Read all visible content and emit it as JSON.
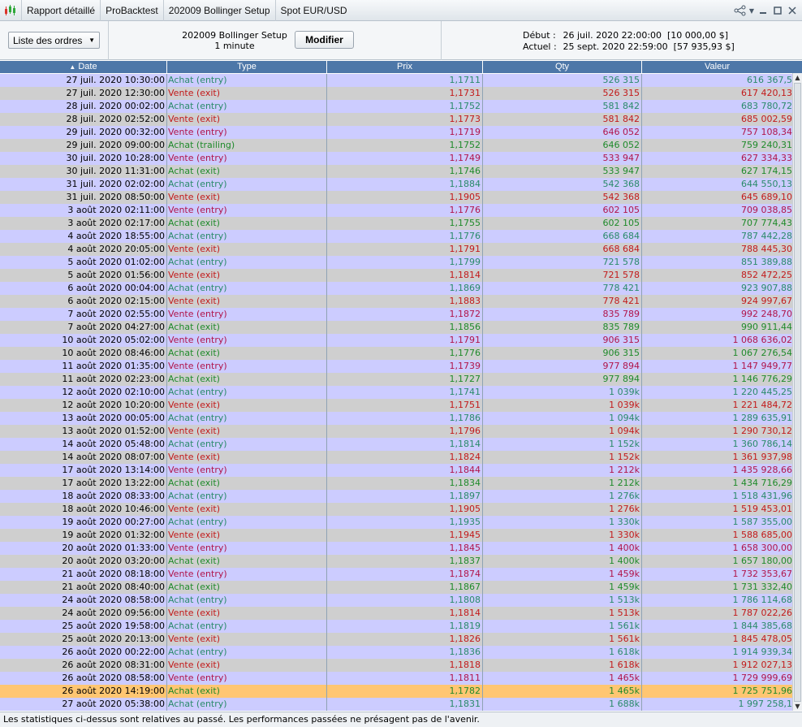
{
  "titlebar": {
    "crumbs": [
      "Rapport détaillé",
      "ProBacktest",
      "202009 Bollinger Setup",
      "Spot EUR/USD"
    ],
    "icons": [
      "chart-icon",
      "share-icon",
      "minimize-icon",
      "maximize-icon",
      "close-icon"
    ]
  },
  "toolbar": {
    "orders_label": "Liste des ordres",
    "setup_name": "202009 Bollinger Setup",
    "timeframe": "1 minute",
    "modify_label": "Modifier",
    "start_label": "Début :",
    "start_value": "26 juil. 2020 22:00:00  [10 000,00 $]",
    "current_label": "Actuel :",
    "current_value": "25 sept. 2020 22:59:00  [57 935,93 $]"
  },
  "columns": [
    "Date",
    "Type",
    "Prix",
    "Qty",
    "Valeur"
  ],
  "rows": [
    [
      "27 juil. 2020 10:30:00",
      "Achat (entry)",
      "1,1711",
      "526 315",
      "616 367,5"
    ],
    [
      "27 juil. 2020 12:30:00",
      "Vente (exit)",
      "1,1731",
      "526 315",
      "617 420,13"
    ],
    [
      "28 juil. 2020 00:02:00",
      "Achat (entry)",
      "1,1752",
      "581 842",
      "683 780,72"
    ],
    [
      "28 juil. 2020 02:52:00",
      "Vente (exit)",
      "1,1773",
      "581 842",
      "685 002,59"
    ],
    [
      "29 juil. 2020 00:32:00",
      "Vente (entry)",
      "1,1719",
      "646 052",
      "757 108,34"
    ],
    [
      "29 juil. 2020 09:00:00",
      "Achat (trailing)",
      "1,1752",
      "646 052",
      "759 240,31"
    ],
    [
      "30 juil. 2020 10:28:00",
      "Vente (entry)",
      "1,1749",
      "533 947",
      "627 334,33"
    ],
    [
      "30 juil. 2020 11:31:00",
      "Achat (exit)",
      "1,1746",
      "533 947",
      "627 174,15"
    ],
    [
      "31 juil. 2020 02:02:00",
      "Achat (entry)",
      "1,1884",
      "542 368",
      "644 550,13"
    ],
    [
      "31 juil. 2020 08:50:00",
      "Vente (exit)",
      "1,1905",
      "542 368",
      "645 689,10"
    ],
    [
      "3 août 2020 02:11:00",
      "Vente (entry)",
      "1,1776",
      "602 105",
      "709 038,85"
    ],
    [
      "3 août 2020 02:17:00",
      "Achat (exit)",
      "1,1755",
      "602 105",
      "707 774,43"
    ],
    [
      "4 août 2020 18:55:00",
      "Achat (entry)",
      "1,1776",
      "668 684",
      "787 442,28"
    ],
    [
      "4 août 2020 20:05:00",
      "Vente (exit)",
      "1,1791",
      "668 684",
      "788 445,30"
    ],
    [
      "5 août 2020 01:02:00",
      "Achat (entry)",
      "1,1799",
      "721 578",
      "851 389,88"
    ],
    [
      "5 août 2020 01:56:00",
      "Vente (exit)",
      "1,1814",
      "721 578",
      "852 472,25"
    ],
    [
      "6 août 2020 00:04:00",
      "Achat (entry)",
      "1,1869",
      "778 421",
      "923 907,88"
    ],
    [
      "6 août 2020 02:15:00",
      "Vente (exit)",
      "1,1883",
      "778 421",
      "924 997,67"
    ],
    [
      "7 août 2020 02:55:00",
      "Vente (entry)",
      "1,1872",
      "835 789",
      "992 248,70"
    ],
    [
      "7 août 2020 04:27:00",
      "Achat (exit)",
      "1,1856",
      "835 789",
      "990 911,44"
    ],
    [
      "10 août 2020 05:02:00",
      "Vente (entry)",
      "1,1791",
      "906 315",
      "1 068 636,02"
    ],
    [
      "10 août 2020 08:46:00",
      "Achat (exit)",
      "1,1776",
      "906 315",
      "1 067 276,54"
    ],
    [
      "11 août 2020 01:35:00",
      "Vente (entry)",
      "1,1739",
      "977 894",
      "1 147 949,77"
    ],
    [
      "11 août 2020 02:23:00",
      "Achat (exit)",
      "1,1727",
      "977 894",
      "1 146 776,29"
    ],
    [
      "12 août 2020 02:10:00",
      "Achat (entry)",
      "1,1741",
      "1 039k",
      "1 220 445,25"
    ],
    [
      "12 août 2020 10:20:00",
      "Vente (exit)",
      "1,1751",
      "1 039k",
      "1 221 484,72"
    ],
    [
      "13 août 2020 00:05:00",
      "Achat (entry)",
      "1,1786",
      "1 094k",
      "1 289 635,91"
    ],
    [
      "13 août 2020 01:52:00",
      "Vente (exit)",
      "1,1796",
      "1 094k",
      "1 290 730,12"
    ],
    [
      "14 août 2020 05:48:00",
      "Achat (entry)",
      "1,1814",
      "1 152k",
      "1 360 786,14"
    ],
    [
      "14 août 2020 08:07:00",
      "Vente (exit)",
      "1,1824",
      "1 152k",
      "1 361 937,98"
    ],
    [
      "17 août 2020 13:14:00",
      "Vente (entry)",
      "1,1844",
      "1 212k",
      "1 435 928,66"
    ],
    [
      "17 août 2020 13:22:00",
      "Achat (exit)",
      "1,1834",
      "1 212k",
      "1 434 716,29"
    ],
    [
      "18 août 2020 08:33:00",
      "Achat (entry)",
      "1,1897",
      "1 276k",
      "1 518 431,96"
    ],
    [
      "18 août 2020 10:46:00",
      "Vente (exit)",
      "1,1905",
      "1 276k",
      "1 519 453,01"
    ],
    [
      "19 août 2020 00:27:00",
      "Achat (entry)",
      "1,1935",
      "1 330k",
      "1 587 355,00"
    ],
    [
      "19 août 2020 01:32:00",
      "Vente (exit)",
      "1,1945",
      "1 330k",
      "1 588 685,00"
    ],
    [
      "20 août 2020 01:33:00",
      "Vente (entry)",
      "1,1845",
      "1 400k",
      "1 658 300,00"
    ],
    [
      "20 août 2020 03:20:00",
      "Achat (exit)",
      "1,1837",
      "1 400k",
      "1 657 180,00"
    ],
    [
      "21 août 2020 08:18:00",
      "Vente (entry)",
      "1,1874",
      "1 459k",
      "1 732 353,67"
    ],
    [
      "21 août 2020 08:40:00",
      "Achat (exit)",
      "1,1867",
      "1 459k",
      "1 731 332,40"
    ],
    [
      "24 août 2020 08:58:00",
      "Achat (entry)",
      "1,1808",
      "1 513k",
      "1 786 114,68"
    ],
    [
      "24 août 2020 09:56:00",
      "Vente (exit)",
      "1,1814",
      "1 513k",
      "1 787 022,26"
    ],
    [
      "25 août 2020 19:58:00",
      "Achat (entry)",
      "1,1819",
      "1 561k",
      "1 844 385,68"
    ],
    [
      "25 août 2020 20:13:00",
      "Vente (exit)",
      "1,1826",
      "1 561k",
      "1 845 478,05"
    ],
    [
      "26 août 2020 00:22:00",
      "Achat (entry)",
      "1,1836",
      "1 618k",
      "1 914 939,34"
    ],
    [
      "26 août 2020 08:31:00",
      "Vente (exit)",
      "1,1818",
      "1 618k",
      "1 912 027,13"
    ],
    [
      "26 août 2020 08:58:00",
      "Vente (entry)",
      "1,1811",
      "1 465k",
      "1 729 999,69"
    ],
    [
      "26 août 2020 14:19:00",
      "Achat (exit)",
      "1,1782",
      "1 465k",
      "1 725 751,96"
    ],
    [
      "27 août 2020 05:38:00",
      "Achat (entry)",
      "1,1831",
      "1 688k",
      "1 997 258,1"
    ]
  ],
  "selected_row": 47,
  "colors": {
    "header_bg": "#4d77a8",
    "row_odd": "#ccccff",
    "row_even": "#cfcfcf",
    "row_selected": "#ffc672",
    "buy": "#1f8a2a",
    "sell": "#c21a1a"
  },
  "footer_text": "Les statistiques ci-dessus sont relatives au passé. Les performances passées ne présagent pas de l'avenir."
}
